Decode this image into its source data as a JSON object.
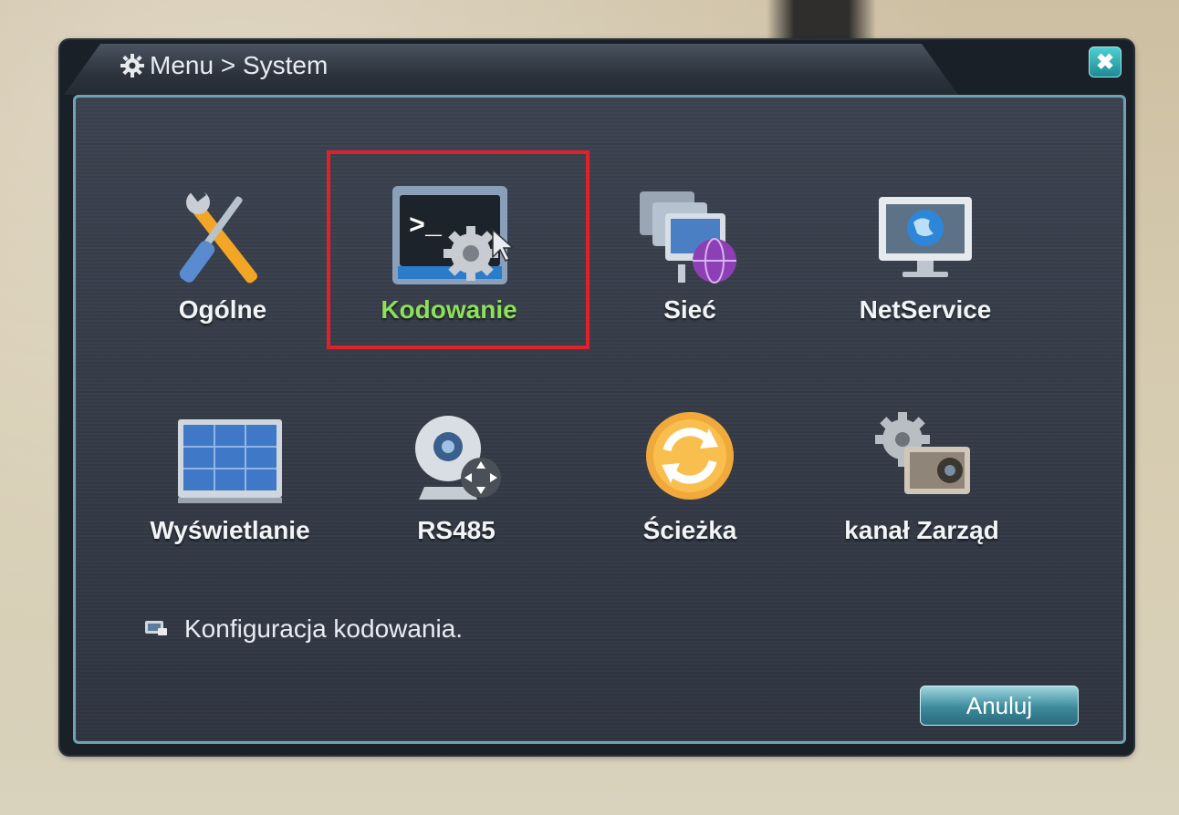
{
  "window": {
    "title": "Menu > System",
    "close_label": "✖"
  },
  "menu": {
    "selected": "Kodowanie",
    "items": [
      {
        "label": "Ogólne",
        "icon": "wrench-screwdriver-icon"
      },
      {
        "label": "Kodowanie",
        "icon": "terminal-gear-icon"
      },
      {
        "label": "Sieć",
        "icon": "network-globe-icon"
      },
      {
        "label": "NetService",
        "icon": "monitor-globe-icon"
      },
      {
        "label": "Wyświetlanie",
        "icon": "display-grid-icon"
      },
      {
        "label": "RS485",
        "icon": "ptz-camera-icon"
      },
      {
        "label": "Ścieżka",
        "icon": "refresh-orange-icon"
      },
      {
        "label": "kanał Zarząd",
        "icon": "camera-gear-icon"
      }
    ]
  },
  "hint": {
    "text": "Konfiguracja kodowania."
  },
  "footer": {
    "cancel_label": "Anuluj"
  },
  "colors": {
    "selected_label": "#8ee05a",
    "highlight_box": "#e3202a",
    "panel_border": "#6fa3b4"
  }
}
